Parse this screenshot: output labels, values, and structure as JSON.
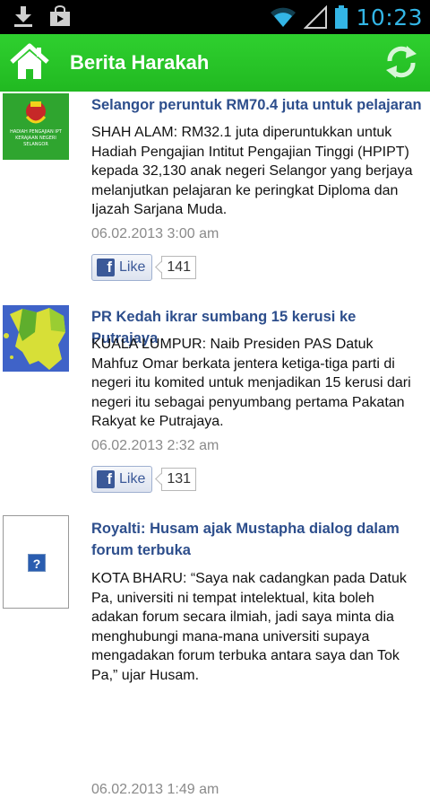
{
  "status_bar": {
    "time": "10:23",
    "icons": [
      "download-icon",
      "store-icon",
      "wifi-icon",
      "signal-icon",
      "battery-icon"
    ]
  },
  "action_bar": {
    "title": "Berita Harakah",
    "home_icon": "home-icon",
    "refresh_icon": "refresh-icon",
    "color": "#22bb22"
  },
  "articles": [
    {
      "title": "Selangor peruntuk RM70.4 juta untuk pelajaran",
      "summary": "SHAH ALAM: RM32.1 juta diperuntukkan untuk Hadiah Pengajian Intitut Pengajian Tinggi (HPIPT) kepada 32,130 anak negeri Selangor yang berjaya melanjutkan pelajaran ke peringkat Diploma dan Ijazah Sarjana Muda.",
      "date": "06.02.2013 3:00 am",
      "like_label": "Like",
      "like_count": "141",
      "thumb_lines": [
        "HADIAH PENGAJIAN IPT",
        "KERAJAAN NEGERI SELANGOR"
      ]
    },
    {
      "title": "PR Kedah ikrar sumbang 15 kerusi ke Putrajaya",
      "summary": "KUALA LUMPUR: Naib Presiden PAS Datuk Mahfuz Omar berkata jentera ketiga-tiga parti di negeri itu komited untuk menjadikan 15 kerusi dari negeri itu sebagai penyumbang pertama Pakatan Rakyat ke Putrajaya.",
      "date": "06.02.2013 2:32 am",
      "like_label": "Like",
      "like_count": "131"
    },
    {
      "title": "Royalti: Husam ajak Mustapha dialog dalam forum terbuka",
      "summary": "KOTA BHARU: “Saya nak cadangkan pada Datuk Pa, universiti ni tempat intelektual, kita boleh adakan forum secara ilmiah, jadi saya minta dia menghubungi mana-mana universiti supaya mengadakan forum terbuka antara saya dan Tok Pa,” ujar Husam.",
      "date": "06.02.2013 1:49 am",
      "placeholder_glyph": "?"
    }
  ]
}
